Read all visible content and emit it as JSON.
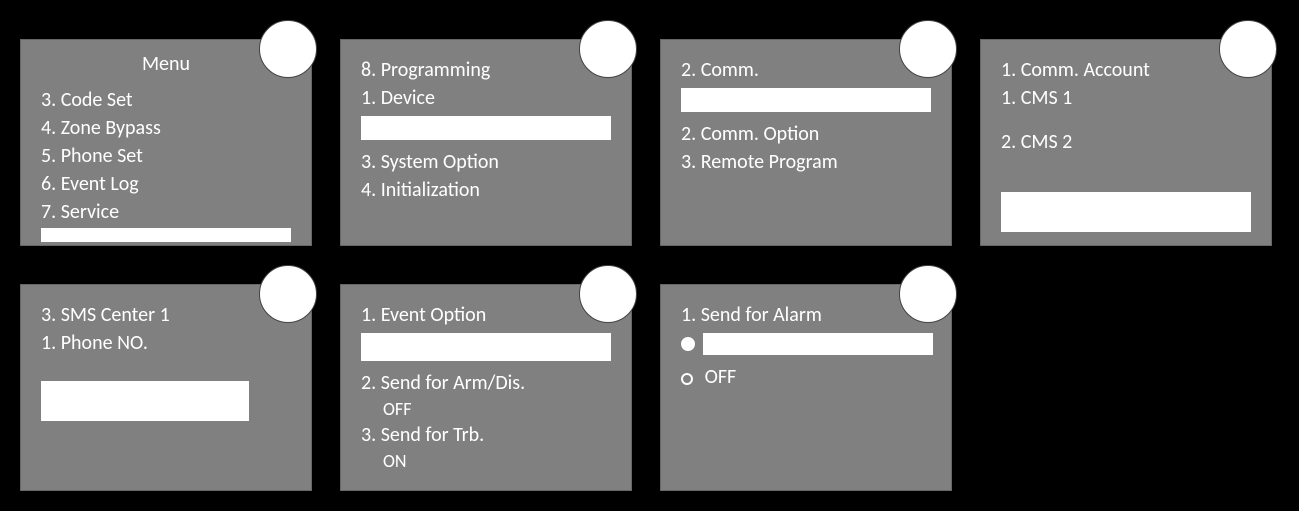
{
  "panel1": {
    "title": "Menu",
    "items": [
      "3. Code Set",
      "4. Zone Bypass",
      "5. Phone Set",
      "6. Event Log",
      "7. Service"
    ]
  },
  "panel2": {
    "items": [
      "8. Programming",
      "1. Device",
      "3. System Option",
      "4. Initialization"
    ]
  },
  "panel3": {
    "items": [
      "2. Comm.",
      "2. Comm. Option",
      "3. Remote Program"
    ]
  },
  "panel4": {
    "items": [
      "1. Comm. Account",
      "1. CMS 1",
      "2. CMS 2"
    ]
  },
  "panel5": {
    "items": [
      "3. SMS Center 1",
      "1. Phone NO."
    ]
  },
  "panel6": {
    "top": "1. Event Option",
    "i2": "2. Send for Arm/Dis.",
    "i2v": "OFF",
    "i3": "3. Send for Trb.",
    "i3v": "ON"
  },
  "panel7": {
    "top": "1. Send for Alarm",
    "off": "OFF"
  }
}
